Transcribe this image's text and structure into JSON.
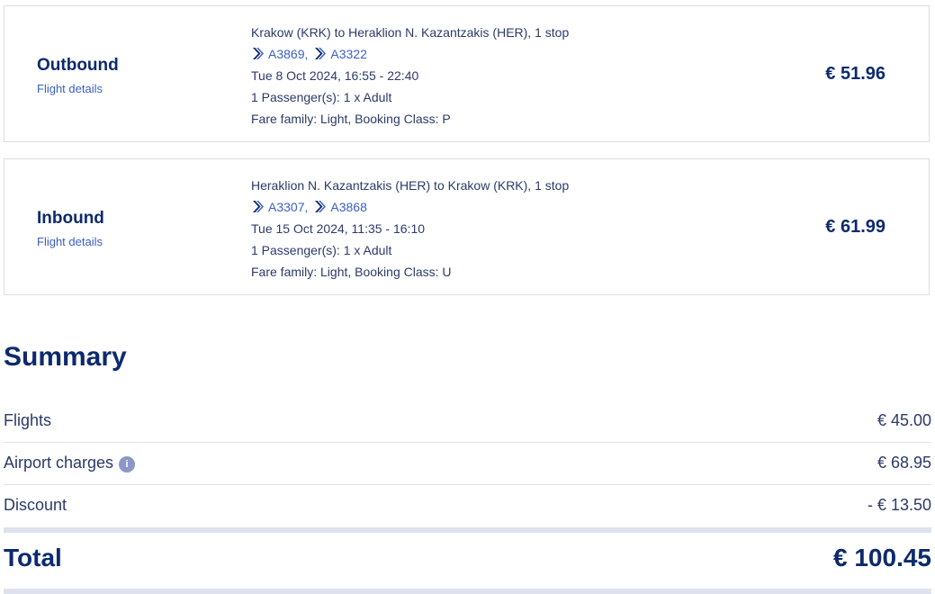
{
  "colors": {
    "primary_text": "#0d2a6e",
    "secondary_text": "#2b3a6a",
    "link": "#3a5fc7",
    "border": "#dcdde4",
    "divider": "#dfe2ee",
    "info_icon_bg": "#8b98c7"
  },
  "outbound": {
    "title": "Outbound",
    "details_link": "Flight details",
    "route": "Krakow (KRK) to Heraklion N. Kazantzakis (HER), 1 stop",
    "flights": [
      {
        "number": "A3869",
        "separator": ","
      },
      {
        "number": "A3322",
        "separator": ""
      }
    ],
    "flight_icon": "aegean-arrow-icon",
    "datetime": "Tue 8 Oct 2024, 16:55 - 22:40",
    "passengers": "1 Passenger(s): 1 x Adult",
    "fare": "Fare family: Light, Booking Class: P",
    "price": "€ 51.96"
  },
  "inbound": {
    "title": "Inbound",
    "details_link": "Flight details",
    "route": "Heraklion N. Kazantzakis (HER) to Krakow (KRK), 1 stop",
    "flights": [
      {
        "number": "A3307",
        "separator": ","
      },
      {
        "number": "A3868",
        "separator": ""
      }
    ],
    "flight_icon": "aegean-arrow-icon",
    "datetime": "Tue 15 Oct 2024, 11:35 - 16:10",
    "passengers": "1 Passenger(s): 1 x Adult",
    "fare": "Fare family: Light, Booking Class: U",
    "price": "€ 61.99"
  },
  "summary": {
    "title": "Summary",
    "rows": [
      {
        "label": "Flights",
        "value": "€ 45.00"
      },
      {
        "label": "Airport charges",
        "value": "€ 68.95",
        "info_icon": "i"
      },
      {
        "label": "Discount",
        "value": "- € 13.50"
      }
    ],
    "total_label": "Total",
    "total_value": "€ 100.45"
  }
}
